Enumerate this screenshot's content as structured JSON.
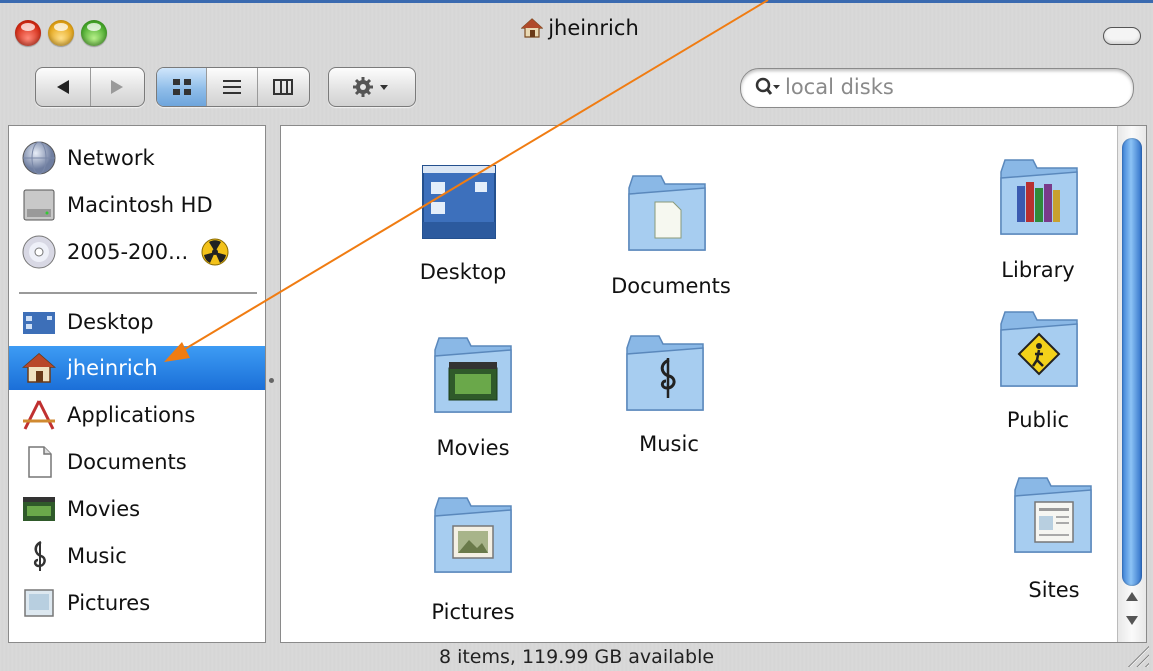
{
  "window": {
    "title": "jheinrich",
    "status_text": "8 items, 119.99 GB available"
  },
  "toolbar": {
    "back_icon": "back-arrow-icon",
    "forward_icon": "forward-arrow-icon",
    "view_icon_mode": "icon-view-icon",
    "view_list_mode": "list-view-icon",
    "view_column_mode": "column-view-icon",
    "action_icon": "gear-icon",
    "active_view": "icon"
  },
  "search": {
    "placeholder": "local disks"
  },
  "sidebar": {
    "devices": [
      {
        "label": "Network",
        "icon": "network-globe-icon"
      },
      {
        "label": "Macintosh HD",
        "icon": "hard-disk-icon"
      },
      {
        "label": "2005-200...",
        "icon": "cd-disc-icon"
      }
    ],
    "places": [
      {
        "label": "Desktop",
        "icon": "desktop-icon"
      },
      {
        "label": "jheinrich",
        "icon": "home-icon",
        "selected": true
      },
      {
        "label": "Applications",
        "icon": "applications-icon"
      },
      {
        "label": "Documents",
        "icon": "documents-icon"
      },
      {
        "label": "Movies",
        "icon": "movies-icon"
      },
      {
        "label": "Music",
        "icon": "music-note-icon"
      },
      {
        "label": "Pictures",
        "icon": "pictures-icon"
      }
    ]
  },
  "content": {
    "items": [
      {
        "label": "Desktop",
        "icon": "desktop-folder-icon"
      },
      {
        "label": "Documents",
        "icon": "documents-folder-icon"
      },
      {
        "label": "Library",
        "icon": "library-folder-icon"
      },
      {
        "label": "Movies",
        "icon": "movies-folder-icon"
      },
      {
        "label": "Music",
        "icon": "music-folder-icon"
      },
      {
        "label": "Public",
        "icon": "public-folder-icon"
      },
      {
        "label": "Pictures",
        "icon": "pictures-folder-icon"
      },
      {
        "label": "Sites",
        "icon": "sites-folder-icon"
      }
    ]
  },
  "colors": {
    "selection": "#1b6fd8",
    "pointer_arrow": "#f07c12",
    "folder_blue": "#8ab8e6"
  }
}
